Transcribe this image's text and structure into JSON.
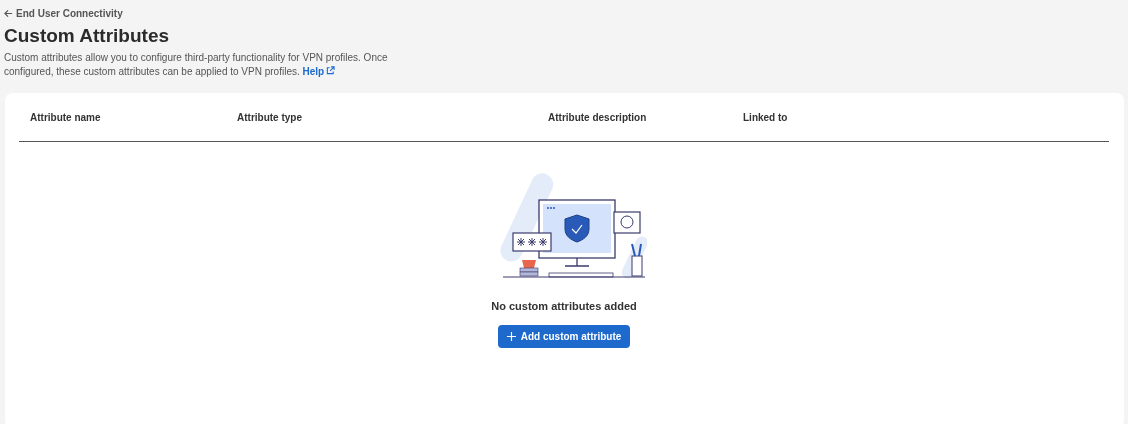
{
  "breadcrumb": {
    "label": "End User Connectivity"
  },
  "title": "Custom Attributes",
  "description": "Custom attributes allow you to configure third-party functionality for VPN profiles. Once configured, these custom attributes can be applied to VPN profiles.",
  "help_link": "Help",
  "table": {
    "columns": [
      "Attribute name",
      "Attribute type",
      "Attribute description",
      "Linked to"
    ]
  },
  "empty_state": {
    "message": "No custom attributes added",
    "button": "Add custom attribute"
  }
}
